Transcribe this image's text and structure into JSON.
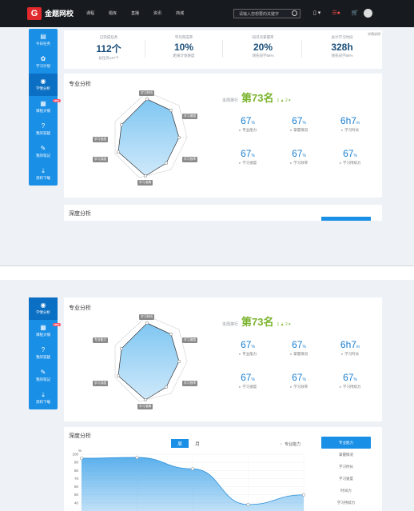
{
  "nav": {
    "logo_text": "金题网校",
    "items": [
      "课程",
      "题库",
      "直播",
      "资讯",
      "商城"
    ],
    "search_placeholder": "请输入您想要的关键字",
    "icons": [
      "phone-icon",
      "message-icon",
      "cart-icon",
      "user-icon"
    ]
  },
  "sidebar": {
    "items": [
      {
        "label": "今日任务",
        "icon": "calendar-icon"
      },
      {
        "label": "学习计划",
        "icon": "plan-icon"
      },
      {
        "label": "学情分析",
        "icon": "analysis-icon"
      },
      {
        "label": "课程大纲",
        "icon": "syllabus-icon",
        "badge": "new"
      },
      {
        "label": "我的答疑",
        "icon": "question-icon"
      },
      {
        "label": "我的笔记",
        "icon": "pencil-icon"
      },
      {
        "label": "资料下载",
        "icon": "download-icon"
      }
    ]
  },
  "stats": [
    {
      "label": "已完成任务",
      "value": "112个",
      "sub": "总任务127个"
    },
    {
      "label": "平均完成率",
      "value": "10%",
      "sub": "距离计划进度"
    },
    {
      "label": "知识点掌握率",
      "value": "20%",
      "sub": "领先同学56%"
    },
    {
      "label": "总计学习时间",
      "value": "328h",
      "sub": "领先同学56%"
    }
  ],
  "stats_link": "学情说明",
  "analysis": {
    "title": "专业分析",
    "rank_label": "本周排行",
    "rank_value": "第73名",
    "rank_change": "1 ▲ 2 ▾",
    "radar_labels": [
      "学习时间",
      "学习速度",
      "学习效率",
      "学习准确",
      "学习深度",
      "学习态度",
      "专业能力"
    ],
    "metrics": [
      {
        "value": "67",
        "unit": "%",
        "label": "专业能力"
      },
      {
        "value": "67",
        "unit": "%",
        "label": "掌握情况"
      },
      {
        "value": "6h7",
        "unit": "m",
        "label": "学习时长"
      },
      {
        "value": "67",
        "unit": "%",
        "label": "学习速度"
      },
      {
        "value": "67",
        "unit": "%",
        "label": "学习效率"
      },
      {
        "value": "67",
        "unit": "%",
        "label": "学习持续力"
      }
    ]
  },
  "depth": {
    "title": "深度分析",
    "tabs": [
      "周",
      "月"
    ],
    "legend": "专业能力",
    "metric_list": [
      "专业能力",
      "掌握情况",
      "学习时长",
      "学习速度",
      "时间力",
      "学习持续力"
    ],
    "y_unit": "%"
  },
  "chart_data": {
    "type": "area",
    "ylabel": "%",
    "ylim": [
      30,
      100
    ],
    "yticks": [
      100,
      90,
      80,
      70,
      60,
      50,
      40
    ],
    "series": [
      {
        "name": "专业能力",
        "values": [
          95,
          96,
          82,
          38,
          50
        ]
      }
    ],
    "color": "#4aa8ea"
  }
}
